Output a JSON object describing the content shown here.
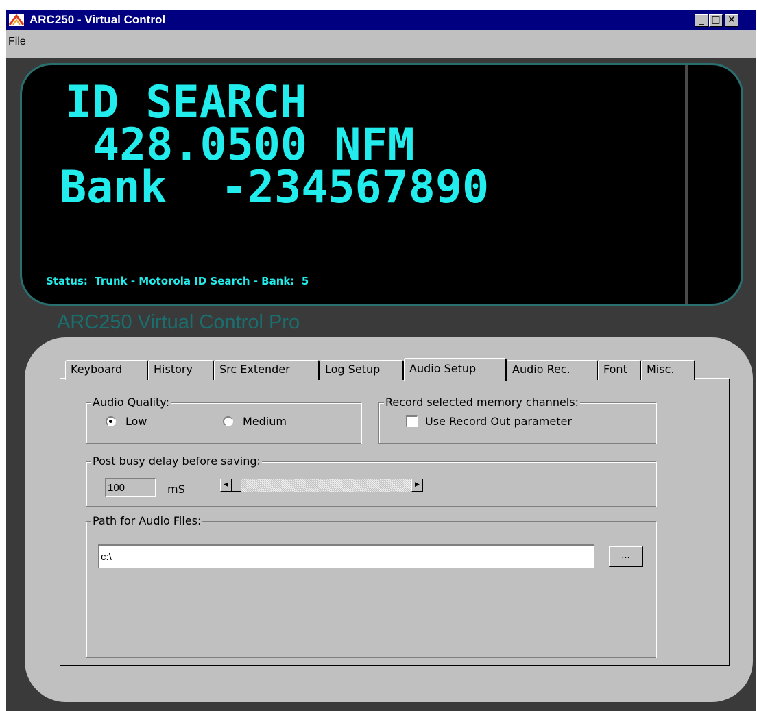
{
  "window": {
    "title": "ARC250 - Virtual Control",
    "minimize_glyph": "_",
    "maximize_glyph": "□",
    "close_glyph": "✕",
    "app_icon": "arc-logo-icon"
  },
  "menubar": {
    "file_label": "File"
  },
  "display": {
    "line1": "ID SEARCH",
    "line2": "428.0500 NFM",
    "line3": "Bank  -234567890",
    "status": "Status:  Trunk - Motorola ID Search - Bank:  5",
    "text_color": "#22ecec"
  },
  "brand_text": "ARC250 Virtual Control Pro",
  "tabs": [
    {
      "label": "Keyboard"
    },
    {
      "label": "History"
    },
    {
      "label": "Src Extender"
    },
    {
      "label": "Log Setup"
    },
    {
      "label": "Audio Setup",
      "active": true
    },
    {
      "label": "Audio Rec."
    },
    {
      "label": "Font"
    },
    {
      "label": "Misc."
    }
  ],
  "audio_setup": {
    "quality": {
      "legend": "Audio Quality:",
      "options": [
        {
          "label": "Low",
          "selected": true
        },
        {
          "label": "Medium",
          "selected": false
        }
      ]
    },
    "record": {
      "legend": "Record selected memory channels:",
      "checkbox_label": "Use Record Out parameter",
      "checked": false
    },
    "delay": {
      "legend": "Post busy delay before saving:",
      "value": "100",
      "unit": "mS",
      "left_arrow": "◀",
      "right_arrow": "▶"
    },
    "path": {
      "legend": "Path for Audio Files:",
      "value": "c:\\",
      "browse_label": "..."
    }
  }
}
